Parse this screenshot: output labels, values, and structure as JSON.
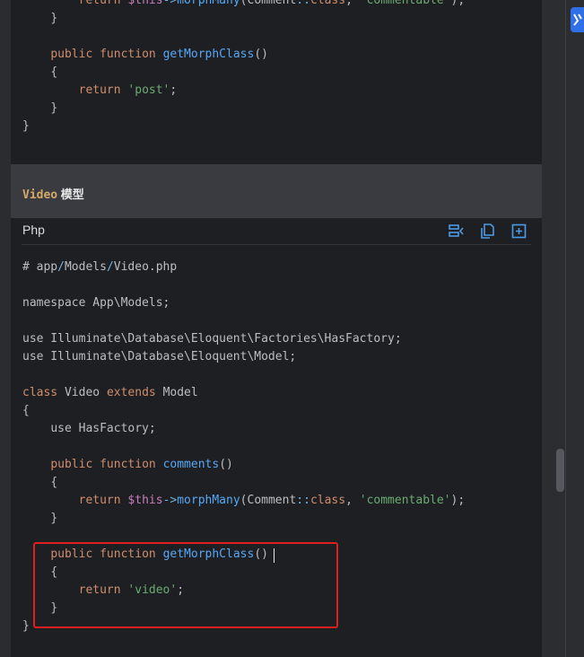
{
  "top_code": {
    "lines": [
      {
        "indent": "        ",
        "parts": [
          [
            "k",
            "return "
          ],
          [
            "v",
            "$this"
          ],
          [
            "sl",
            "->"
          ],
          [
            "f",
            "morphMany"
          ],
          [
            "cm",
            "(Comment"
          ],
          [
            "sl",
            "::"
          ],
          [
            "k",
            "class"
          ],
          [
            "cm",
            ", "
          ],
          [
            "s",
            "'commentable'"
          ],
          [
            "cm",
            ");"
          ]
        ]
      },
      {
        "indent": "    ",
        "parts": [
          [
            "cm",
            "}"
          ]
        ]
      },
      {
        "indent": "",
        "parts": []
      },
      {
        "indent": "    ",
        "parts": [
          [
            "k",
            "public "
          ],
          [
            "k",
            "function "
          ],
          [
            "f",
            "getMorphClass"
          ],
          [
            "cm",
            "()"
          ]
        ]
      },
      {
        "indent": "    ",
        "parts": [
          [
            "cm",
            "{"
          ]
        ]
      },
      {
        "indent": "        ",
        "parts": [
          [
            "k",
            "return "
          ],
          [
            "s",
            "'post'"
          ],
          [
            "cm",
            ";"
          ]
        ]
      },
      {
        "indent": "    ",
        "parts": [
          [
            "cm",
            "}"
          ]
        ]
      },
      {
        "indent": "",
        "parts": [
          [
            "cm",
            "}"
          ]
        ]
      }
    ]
  },
  "heading": {
    "code": "Video",
    "text": " 模型"
  },
  "code_block": {
    "language": "Php",
    "toolbar": [
      "wrap-lines-icon",
      "copy-icon",
      "expand-icon"
    ],
    "lines": [
      {
        "indent": "",
        "parts": [
          [
            "cm",
            "# app"
          ],
          [
            "sl",
            "/"
          ],
          [
            "cm",
            "Models"
          ],
          [
            "sl",
            "/"
          ],
          [
            "cm",
            "Video.php"
          ]
        ]
      },
      {
        "indent": "",
        "parts": []
      },
      {
        "indent": "",
        "parts": [
          [
            "cm",
            "namespace App\\Models;"
          ]
        ]
      },
      {
        "indent": "",
        "parts": []
      },
      {
        "indent": "",
        "parts": [
          [
            "cm",
            "use Illuminate\\Database\\Eloquent\\Factories\\HasFactory;"
          ]
        ]
      },
      {
        "indent": "",
        "parts": [
          [
            "cm",
            "use Illuminate\\Database\\Eloquent\\Model;"
          ]
        ]
      },
      {
        "indent": "",
        "parts": []
      },
      {
        "indent": "",
        "parts": [
          [
            "k",
            "class "
          ],
          [
            "cm",
            "Video "
          ],
          [
            "k",
            "extends "
          ],
          [
            "cm",
            "Model"
          ]
        ]
      },
      {
        "indent": "",
        "parts": [
          [
            "cm",
            "{"
          ]
        ]
      },
      {
        "indent": "    ",
        "parts": [
          [
            "cm",
            "use HasFactory;"
          ]
        ]
      },
      {
        "indent": "",
        "parts": []
      },
      {
        "indent": "    ",
        "parts": [
          [
            "k",
            "public "
          ],
          [
            "k",
            "function "
          ],
          [
            "f",
            "comments"
          ],
          [
            "cm",
            "()"
          ]
        ]
      },
      {
        "indent": "    ",
        "parts": [
          [
            "cm",
            "{"
          ]
        ]
      },
      {
        "indent": "        ",
        "parts": [
          [
            "k",
            "return "
          ],
          [
            "v",
            "$this"
          ],
          [
            "sl",
            "->"
          ],
          [
            "f",
            "morphMany"
          ],
          [
            "cm",
            "(Comment"
          ],
          [
            "sl",
            "::"
          ],
          [
            "k",
            "class"
          ],
          [
            "cm",
            ", "
          ],
          [
            "s",
            "'commentable'"
          ],
          [
            "cm",
            ");"
          ]
        ]
      },
      {
        "indent": "    ",
        "parts": [
          [
            "cm",
            "}"
          ]
        ]
      },
      {
        "indent": "",
        "parts": []
      },
      {
        "indent": "    ",
        "parts": [
          [
            "k",
            "public "
          ],
          [
            "k",
            "function "
          ],
          [
            "f",
            "getMorphClass"
          ],
          [
            "cm",
            "()"
          ]
        ]
      },
      {
        "indent": "    ",
        "parts": [
          [
            "cm",
            "{"
          ]
        ]
      },
      {
        "indent": "        ",
        "parts": [
          [
            "k",
            "return "
          ],
          [
            "s",
            "'video'"
          ],
          [
            "cm",
            ";"
          ]
        ]
      },
      {
        "indent": "    ",
        "parts": [
          [
            "cm",
            "}"
          ]
        ]
      },
      {
        "indent": "",
        "parts": [
          [
            "cm",
            "}"
          ]
        ]
      }
    ]
  },
  "colors": {
    "highlight_box": "#e0201d",
    "accent": "#2f6fe8"
  }
}
